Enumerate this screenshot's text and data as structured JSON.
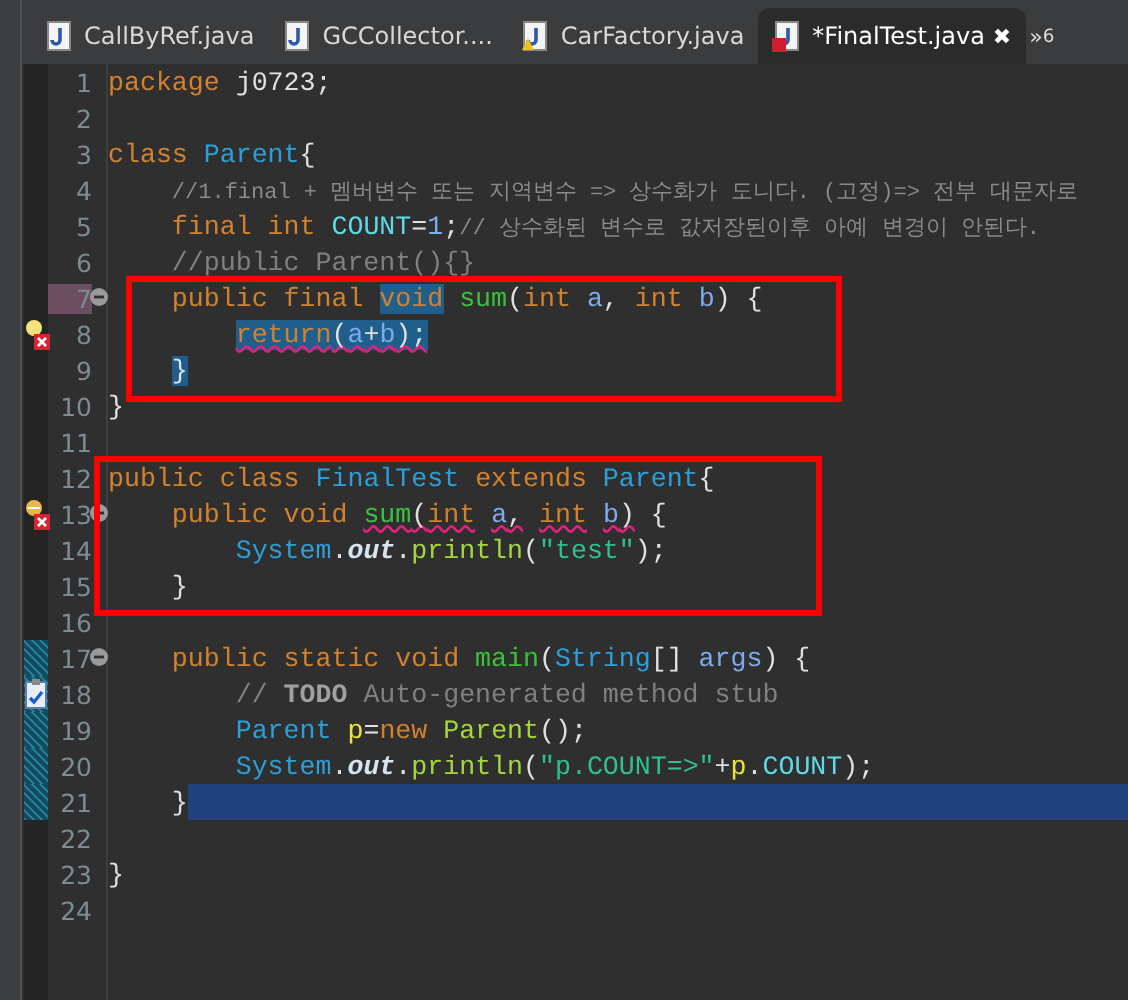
{
  "tabs": [
    {
      "label": "CallByRef.java",
      "selected": false,
      "warning": false,
      "error": false
    },
    {
      "label": "GCCollector....",
      "selected": false,
      "warning": false,
      "error": false
    },
    {
      "label": "CarFactory.java",
      "selected": false,
      "warning": true,
      "error": false
    },
    {
      "label": "*FinalTest.java",
      "selected": true,
      "warning": false,
      "error": true,
      "close": "✖"
    }
  ],
  "overflow": {
    "chevron": "»",
    "count": "6"
  },
  "lines": [
    {
      "number": "1",
      "tokens": [
        {
          "kind": "keyword",
          "text": "package"
        },
        {
          "kind": "plain",
          "text": " j0723;"
        }
      ]
    },
    {
      "number": "2"
    },
    {
      "number": "3",
      "tokens": [
        {
          "kind": "keyword",
          "text": "class"
        },
        {
          "kind": "type",
          "text": " Parent"
        },
        {
          "kind": "plain",
          "text": "{"
        }
      ]
    },
    {
      "number": "4",
      "tokens": [
        {
          "kind": "comment_small",
          "text": "    //1.final + 멤버변수 또는 지역변수 => 상수화가 도니다. (고정)=> 전부 대문자로"
        }
      ]
    },
    {
      "number": "5",
      "tokens": [
        {
          "kind": "keyword",
          "text": "    final int"
        },
        {
          "kind": "field",
          "text": " COUNT"
        },
        {
          "kind": "plain",
          "text": "="
        },
        {
          "kind": "number",
          "text": "1"
        },
        {
          "kind": "plain",
          "text": ";"
        },
        {
          "kind": "comment_small",
          "text": "// 상수화된 변수로 값저장된이후 아예 변경이 안된다."
        }
      ]
    },
    {
      "number": "6",
      "tokens": [
        {
          "kind": "comment",
          "text": "    //public Parent(){}"
        }
      ]
    },
    {
      "number": "7",
      "numberMarked": true,
      "fold": true,
      "tokens": [
        {
          "kind": "keyword",
          "text": "    public final ",
          "selected": false
        },
        {
          "kind": "keyword",
          "text": "void",
          "selected": true
        },
        {
          "kind": "method",
          "text": " sum",
          "selected": false
        },
        {
          "kind": "plain",
          "text": "(",
          "selected": false
        },
        {
          "kind": "keyword",
          "text": "int",
          "selected": false
        },
        {
          "kind": "param",
          "text": " a",
          "selected": false
        },
        {
          "kind": "plain",
          "text": ",",
          "selected": false
        },
        {
          "kind": "keyword",
          "text": " int",
          "selected": false
        },
        {
          "kind": "param",
          "text": " b",
          "selected": false
        },
        {
          "kind": "plain",
          "text": ") {",
          "selected": false
        }
      ]
    },
    {
      "number": "8",
      "problem": true,
      "tokens": [
        {
          "kind": "keyword",
          "text": "        return",
          "selected": true,
          "error": true
        },
        {
          "kind": "plain",
          "text": "(",
          "selected": true,
          "error": true
        },
        {
          "kind": "param",
          "text": "a",
          "selected": true,
          "error": true
        },
        {
          "kind": "plain",
          "text": "+",
          "selected": true,
          "error": true
        },
        {
          "kind": "param",
          "text": "b",
          "selected": true,
          "error": true
        },
        {
          "kind": "plain",
          "text": ");",
          "selected": true,
          "error": true
        }
      ]
    },
    {
      "number": "9",
      "tokens": [
        {
          "kind": "plain",
          "text": "    }",
          "selected": true
        }
      ]
    },
    {
      "number": "10",
      "tokens": [
        {
          "kind": "plain",
          "text": "}"
        }
      ]
    },
    {
      "number": "11"
    },
    {
      "number": "12",
      "tokens": [
        {
          "kind": "keyword",
          "text": "public class"
        },
        {
          "kind": "type",
          "text": " FinalTest"
        },
        {
          "kind": "keyword",
          "text": " extends"
        },
        {
          "kind": "type",
          "text": " Parent"
        },
        {
          "kind": "plain",
          "text": "{"
        }
      ]
    },
    {
      "number": "13",
      "problem": true,
      "override": true,
      "fold": true,
      "tokens": [
        {
          "kind": "keyword",
          "text": "    public void",
          "error": false
        },
        {
          "kind": "method",
          "text": " sum",
          "error": true
        },
        {
          "kind": "plain",
          "text": "(",
          "error": true
        },
        {
          "kind": "keyword",
          "text": "int",
          "error": true
        },
        {
          "kind": "param",
          "text": " a",
          "error": true
        },
        {
          "kind": "plain",
          "text": ",",
          "error": true
        },
        {
          "kind": "keyword",
          "text": " int",
          "error": true
        },
        {
          "kind": "param",
          "text": " b",
          "error": true
        },
        {
          "kind": "plain",
          "text": ")",
          "error": true
        },
        {
          "kind": "plain",
          "text": " {",
          "error": false
        }
      ]
    },
    {
      "number": "14",
      "tokens": [
        {
          "kind": "type",
          "text": "        System"
        },
        {
          "kind": "plain",
          "text": "."
        },
        {
          "kind": "static",
          "text": "out"
        },
        {
          "kind": "plain",
          "text": "."
        },
        {
          "kind": "call",
          "text": "println"
        },
        {
          "kind": "plain",
          "text": "("
        },
        {
          "kind": "string",
          "text": "\"test\""
        },
        {
          "kind": "plain",
          "text": ");"
        }
      ]
    },
    {
      "number": "15",
      "tokens": [
        {
          "kind": "plain",
          "text": "    }"
        }
      ]
    },
    {
      "number": "16"
    },
    {
      "number": "17",
      "fold": true,
      "changed": true,
      "tokens": [
        {
          "kind": "keyword",
          "text": "    public static void"
        },
        {
          "kind": "method",
          "text": " main"
        },
        {
          "kind": "plain",
          "text": "("
        },
        {
          "kind": "type",
          "text": "String"
        },
        {
          "kind": "plain",
          "text": "[]"
        },
        {
          "kind": "param",
          "text": " args"
        },
        {
          "kind": "plain",
          "text": ") {"
        }
      ]
    },
    {
      "number": "18",
      "task": true,
      "changed": true,
      "tokens": [
        {
          "kind": "comment",
          "text": "        //"
        },
        {
          "kind": "todo",
          "text": " TODO"
        },
        {
          "kind": "comment",
          "text": " Auto-generated method stub"
        }
      ]
    },
    {
      "number": "19",
      "changed": true,
      "tokens": [
        {
          "kind": "type",
          "text": "        Parent"
        },
        {
          "kind": "local",
          "text": " p"
        },
        {
          "kind": "plain",
          "text": "="
        },
        {
          "kind": "keyword",
          "text": "new"
        },
        {
          "kind": "call",
          "text": " Parent"
        },
        {
          "kind": "plain",
          "text": "();"
        }
      ]
    },
    {
      "number": "20",
      "changed": true,
      "tokens": [
        {
          "kind": "type",
          "text": "        System"
        },
        {
          "kind": "plain",
          "text": "."
        },
        {
          "kind": "static",
          "text": "out"
        },
        {
          "kind": "plain",
          "text": "."
        },
        {
          "kind": "call",
          "text": "println"
        },
        {
          "kind": "plain",
          "text": "("
        },
        {
          "kind": "string",
          "text": "\"p.COUNT=>\""
        },
        {
          "kind": "plain",
          "text": "+"
        },
        {
          "kind": "local",
          "text": "p"
        },
        {
          "kind": "plain",
          "text": "."
        },
        {
          "kind": "field",
          "text": "COUNT"
        },
        {
          "kind": "plain",
          "text": ");"
        }
      ]
    },
    {
      "number": "21",
      "changed": true,
      "current": true,
      "tokens": [
        {
          "kind": "plain",
          "text": "    }"
        }
      ]
    },
    {
      "number": "22"
    },
    {
      "number": "23",
      "tokens": [
        {
          "kind": "plain",
          "text": "}"
        }
      ]
    },
    {
      "number": "24"
    }
  ]
}
